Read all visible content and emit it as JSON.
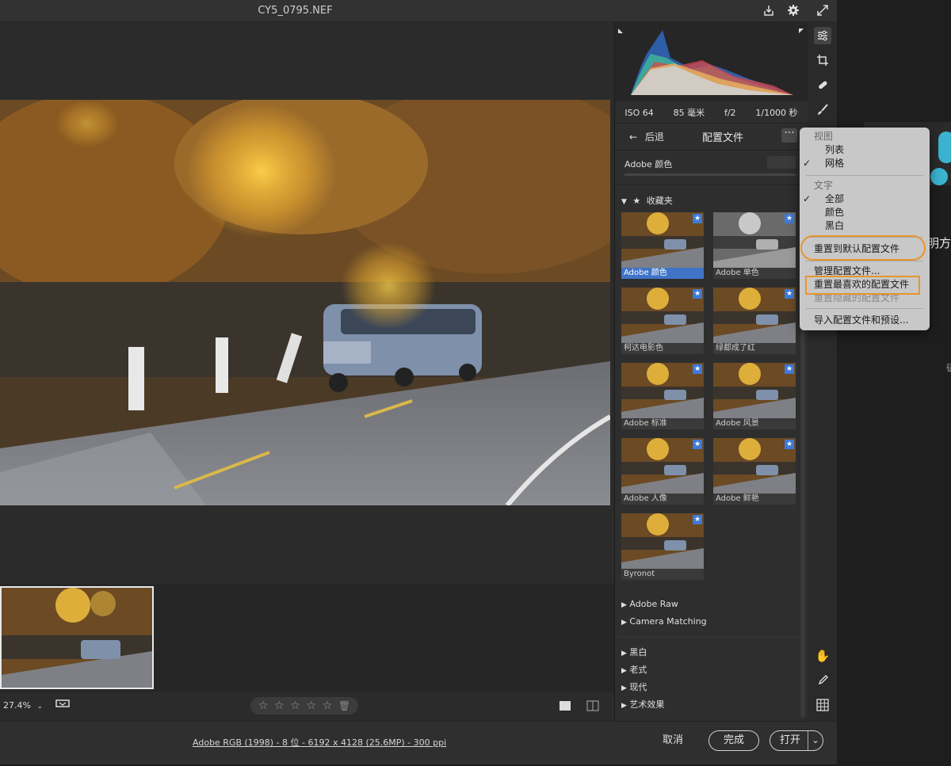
{
  "window": {
    "title": "CY5_0795.NEF"
  },
  "titlebar_icons": [
    "save-icon",
    "gear-icon",
    "fullscreen-icon"
  ],
  "exif": {
    "iso": "ISO 64",
    "focal": "85 毫米",
    "aperture": "f/2",
    "shutter": "1/1000 秒"
  },
  "profile_panel": {
    "back_label": "后退",
    "title": "配置文件",
    "more": "···",
    "current_profile": "Adobe 颜色",
    "favorites_label": "收藏夹",
    "tiles": [
      {
        "label": "Adobe 颜色",
        "selected": true
      },
      {
        "label": "Adobe 单色",
        "selected": false
      },
      {
        "label": "柯达电影色",
        "selected": false
      },
      {
        "label": "绿都成了红",
        "selected": false
      },
      {
        "label": "Adobe 标准",
        "selected": false
      },
      {
        "label": "Adobe 风景",
        "selected": false
      },
      {
        "label": "Adobe 人像",
        "selected": false
      },
      {
        "label": "Adobe 鲜艳",
        "selected": false
      },
      {
        "label": "Byronot",
        "selected": false
      }
    ],
    "groups_a": [
      "Adobe Raw",
      "Camera Matching"
    ],
    "groups_b": [
      "黑白",
      "老式",
      "现代",
      "艺术效果"
    ]
  },
  "menu": {
    "view_header": "视图",
    "view_list": "列表",
    "view_grid": "网格",
    "text_header": "文字",
    "text_all": "全部",
    "text_color": "颜色",
    "text_bw": "黑白",
    "reset_default": "重置到默认配置文件",
    "manage": "管理配置文件...",
    "reset_fav": "重置最喜欢的配置文件",
    "reset_hidden": "重置隐藏的配置文件",
    "import": "导入配置文件和预设..."
  },
  "status": {
    "zoom": "27.4%",
    "rating_stars": 0
  },
  "bottom": {
    "file_info": "Adobe RGB (1998) - 8 位 - 6192 x 4128 (25.6MP) - 300 ppi",
    "cancel": "取消",
    "done": "完成",
    "open": "打开"
  },
  "background_window": {
    "text1": "明方",
    "text2": "征"
  },
  "colors": {
    "accent": "#3f74c7",
    "highlight": "#e8952e"
  }
}
